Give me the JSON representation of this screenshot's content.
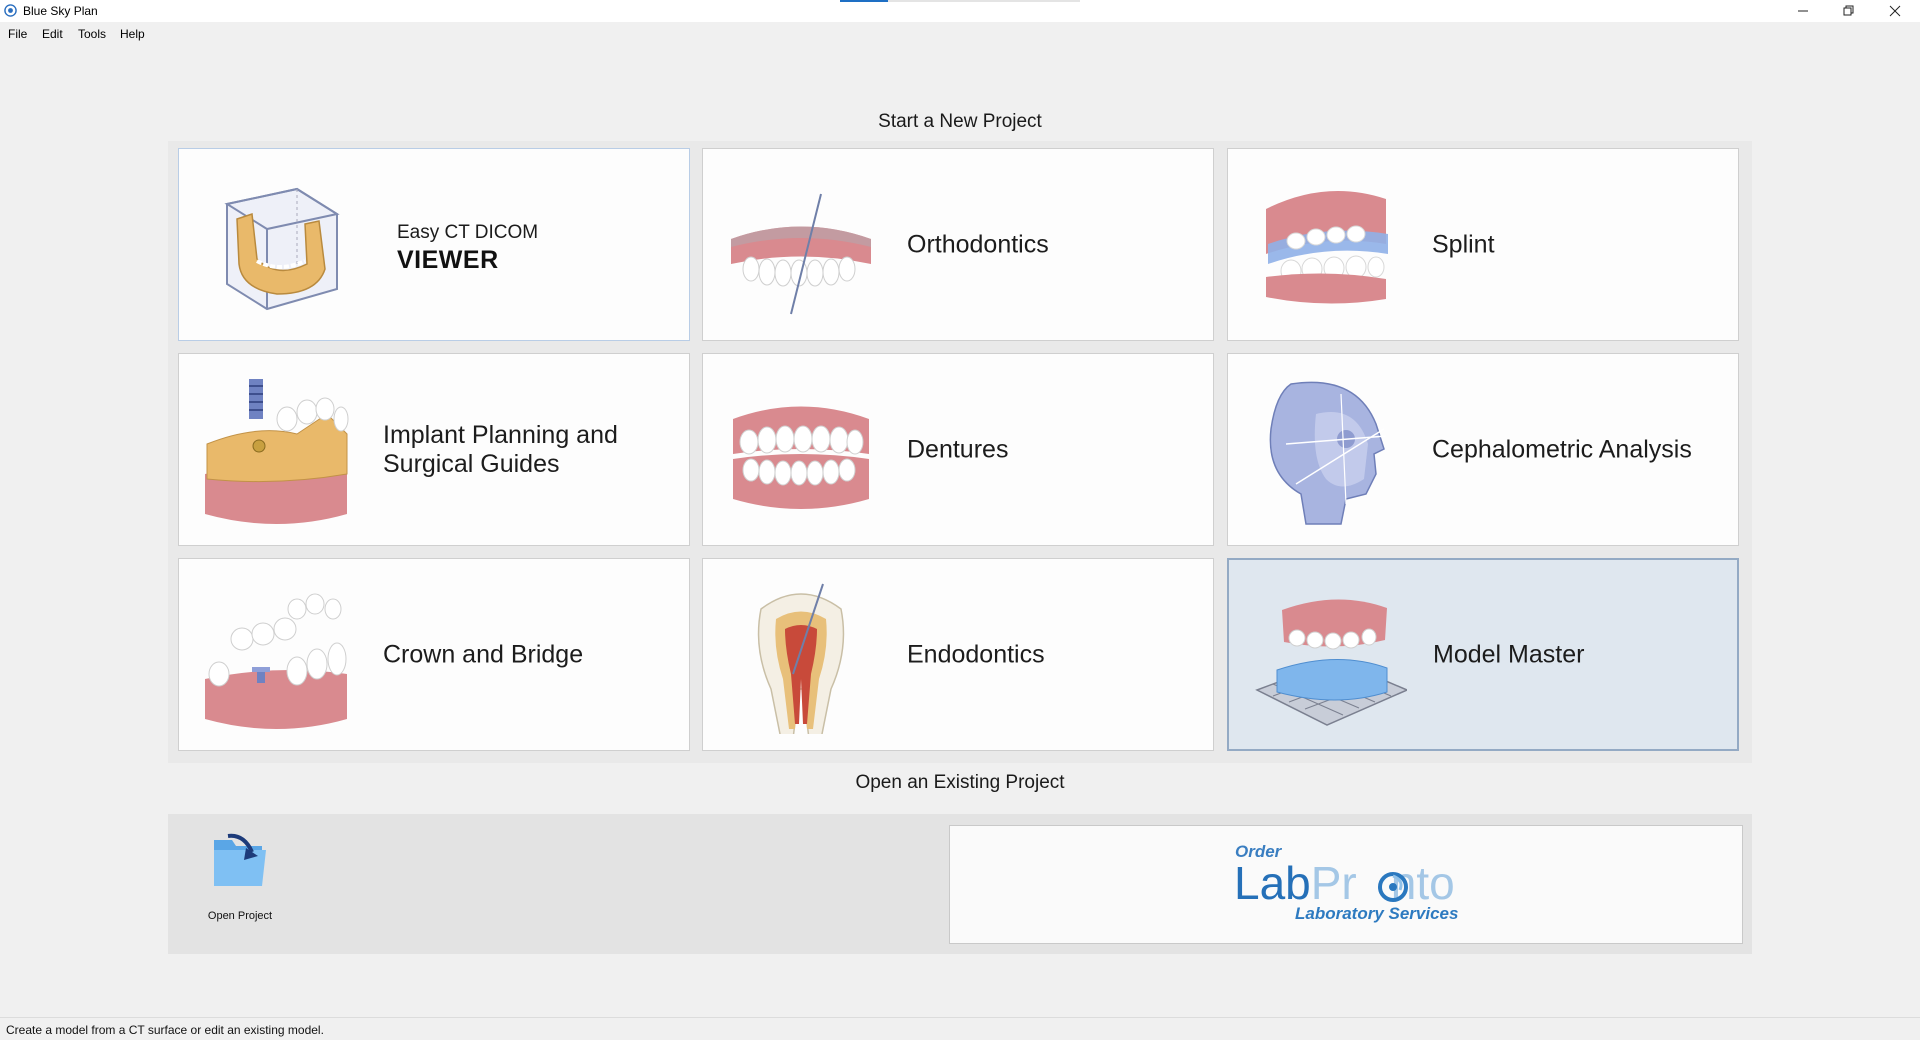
{
  "window": {
    "title": "Blue Sky Plan",
    "progress": 0.2
  },
  "menu": [
    "File",
    "Edit",
    "Tools",
    "Help"
  ],
  "new_project": {
    "heading": "Start a New Project",
    "tiles": [
      {
        "id": "dicom",
        "line1": "Easy CT DICOM",
        "line2": "VIEWER",
        "icon": "ct-cube-jaw-icon"
      },
      {
        "id": "ortho",
        "label": "Orthodontics",
        "icon": "orthodontics-teeth-icon"
      },
      {
        "id": "splint",
        "label": "Splint",
        "icon": "splint-jaws-icon"
      },
      {
        "id": "implant",
        "label": "Implant Planning and\nSurgical Guides",
        "icon": "implant-jaw-icon"
      },
      {
        "id": "dentures",
        "label": "Dentures",
        "icon": "dentures-icon"
      },
      {
        "id": "ceph",
        "label": "Cephalometric Analysis",
        "icon": "skull-profile-icon"
      },
      {
        "id": "crown",
        "label": "Crown and Bridge",
        "icon": "crown-bridge-icon"
      },
      {
        "id": "endo",
        "label": "Endodontics",
        "icon": "tooth-root-canal-icon"
      },
      {
        "id": "model",
        "label": "Model Master",
        "icon": "model-on-grid-icon",
        "selected": true
      }
    ]
  },
  "existing_project": {
    "heading": "Open an Existing Project",
    "open_label": "Open Project",
    "icon": "open-folder-icon"
  },
  "labpronto": {
    "order": "Order",
    "lab": "Lab",
    "pronto_a": "Pr",
    "pronto_b": "nto",
    "subtitle": "Laboratory Services"
  },
  "status": {
    "message": "Create a model from a CT surface or edit an existing model."
  },
  "colors": {
    "accent": "#1e6fc4",
    "selected_tile": "#dfe7ef",
    "gum": "#d98a8f",
    "bone": "#e9b96a",
    "tray": "#7fb6ec",
    "labpronto_blue": "#2570b8"
  }
}
